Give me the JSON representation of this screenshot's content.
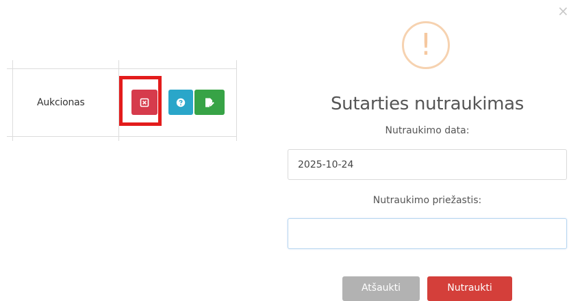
{
  "table": {
    "type_cell": "Aukcionas",
    "actions": [
      {
        "name": "terminate-contract",
        "icon": "close-square-icon",
        "color": "#d63b4c",
        "highlighted": true
      },
      {
        "name": "info",
        "icon": "question-circle-icon",
        "color": "#2aa6c9"
      },
      {
        "name": "edit",
        "icon": "edit-document-icon",
        "color": "#37a346"
      }
    ],
    "highlight_color": "#e31c1c"
  },
  "modal": {
    "close_icon": "close-icon",
    "warning_icon": "exclamation-icon",
    "warning_mark": "!",
    "title": "Sutarties nutraukimas",
    "date_label": "Nutraukimo data:",
    "date_value": "2025-10-24",
    "reason_label": "Nutraukimo priežastis:",
    "reason_value": "",
    "cancel_label": "Atšaukti",
    "confirm_label": "Nutraukti",
    "colors": {
      "warning": "#f5c8a0",
      "cancel_button": "#b2b2b2",
      "confirm_button": "#d43f3a"
    }
  }
}
